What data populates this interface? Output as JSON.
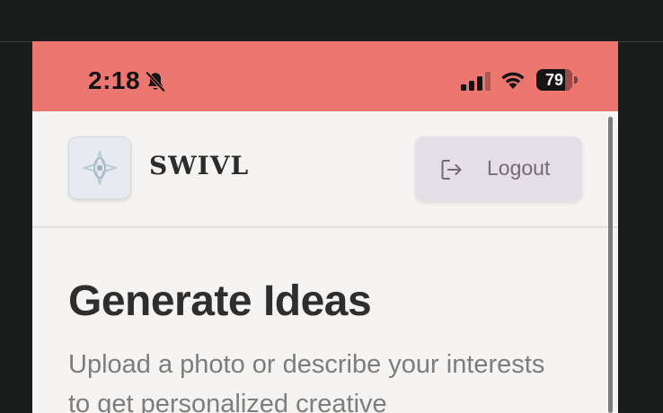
{
  "status_bar": {
    "time": "2:18",
    "battery": "79",
    "battery_level": 0.79,
    "icons": [
      "bell-slash-icon",
      "cellular-signal-icon",
      "wifi-icon",
      "battery-icon"
    ],
    "background": "#ec7670"
  },
  "header": {
    "brand": "SWIVL",
    "logo_icon": "compass-star-icon",
    "logout_label": "Logout",
    "logout_icon": "logout-icon"
  },
  "main": {
    "title": "Generate Ideas",
    "subtitle": "Upload a photo or describe your interests to get personalized creative"
  },
  "colors": {
    "page_background": "#f5f4f2",
    "status_bar": "#ec7670",
    "logout_button": "#e4dfe6",
    "logout_text": "#74687a",
    "title": "#2e2e2e",
    "subtitle": "#7d7d7d"
  }
}
